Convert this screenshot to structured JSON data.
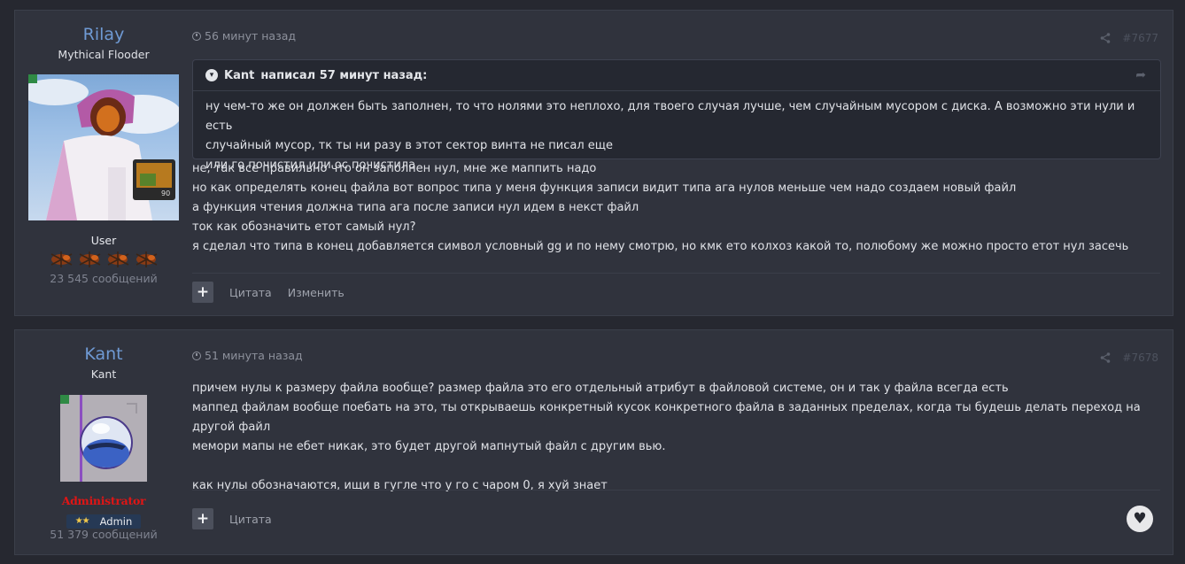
{
  "posts": [
    {
      "author": "Rilay",
      "title": "Mythical Flooder",
      "rank": "User",
      "rank_icon": "fire-ant-icon",
      "posts_count": "23 545 сообщений",
      "time": "56 минут назад",
      "post_number": "#7677",
      "quote": {
        "author": "Kant",
        "header_suffix": "написал 57 минут назад:",
        "lines": [
          "ну чем-то же он должен быть заполнен, то что нолями это неплохо, для твоего случая лучше, чем случайным мусором с диска. А возможно эти нули и есть",
          "случайный мусор, тк ты ни разу в этот сектор винта не писал еще",
          "или го почистил или ос почистила"
        ]
      },
      "lines": [
        "не, так все правильно что он заполнен нул, мне же маппить надо",
        "но как определять конец файла вот вопрос типа у меня функция записи видит типа ага нулов меньше чем надо создаем новый файл",
        "а функция чтения должна типа ага после записи нул идем в некст файл",
        "ток как обозначить етот самый нул?",
        "я сделал что типа в конец добавляется символ условный gg  и по нему смотрю, но кмк ето колхоз какой то, полюбому же можно просто етот нул засечь"
      ],
      "actions": {
        "quote": "Цитата",
        "edit": "Изменить"
      }
    },
    {
      "author": "Kant",
      "title": "Kant",
      "role": "Administrator",
      "badge": {
        "stars": "★★",
        "label": "Admin"
      },
      "posts_count": "51 379 сообщений",
      "time": "51 минута назад",
      "post_number": "#7678",
      "lines": [
        "причем нулы к размеру файла вообще? размер файла это его отдельный атрибут в файловой системе, он и так у файла всегда есть",
        "маппед файлам вообще поебать на это, ты открываешь конкретный кусок конкретного файла в заданных пределах, когда ты будешь делать переход на другой файл",
        "мемори мапы не ебет никак, это будет другой мапнутый файл с другим вью.",
        "",
        "как нулы обозначаются, ищи в гугле что у го с чаром 0, я хуй знает"
      ],
      "actions": {
        "quote": "Цитата"
      }
    }
  ]
}
